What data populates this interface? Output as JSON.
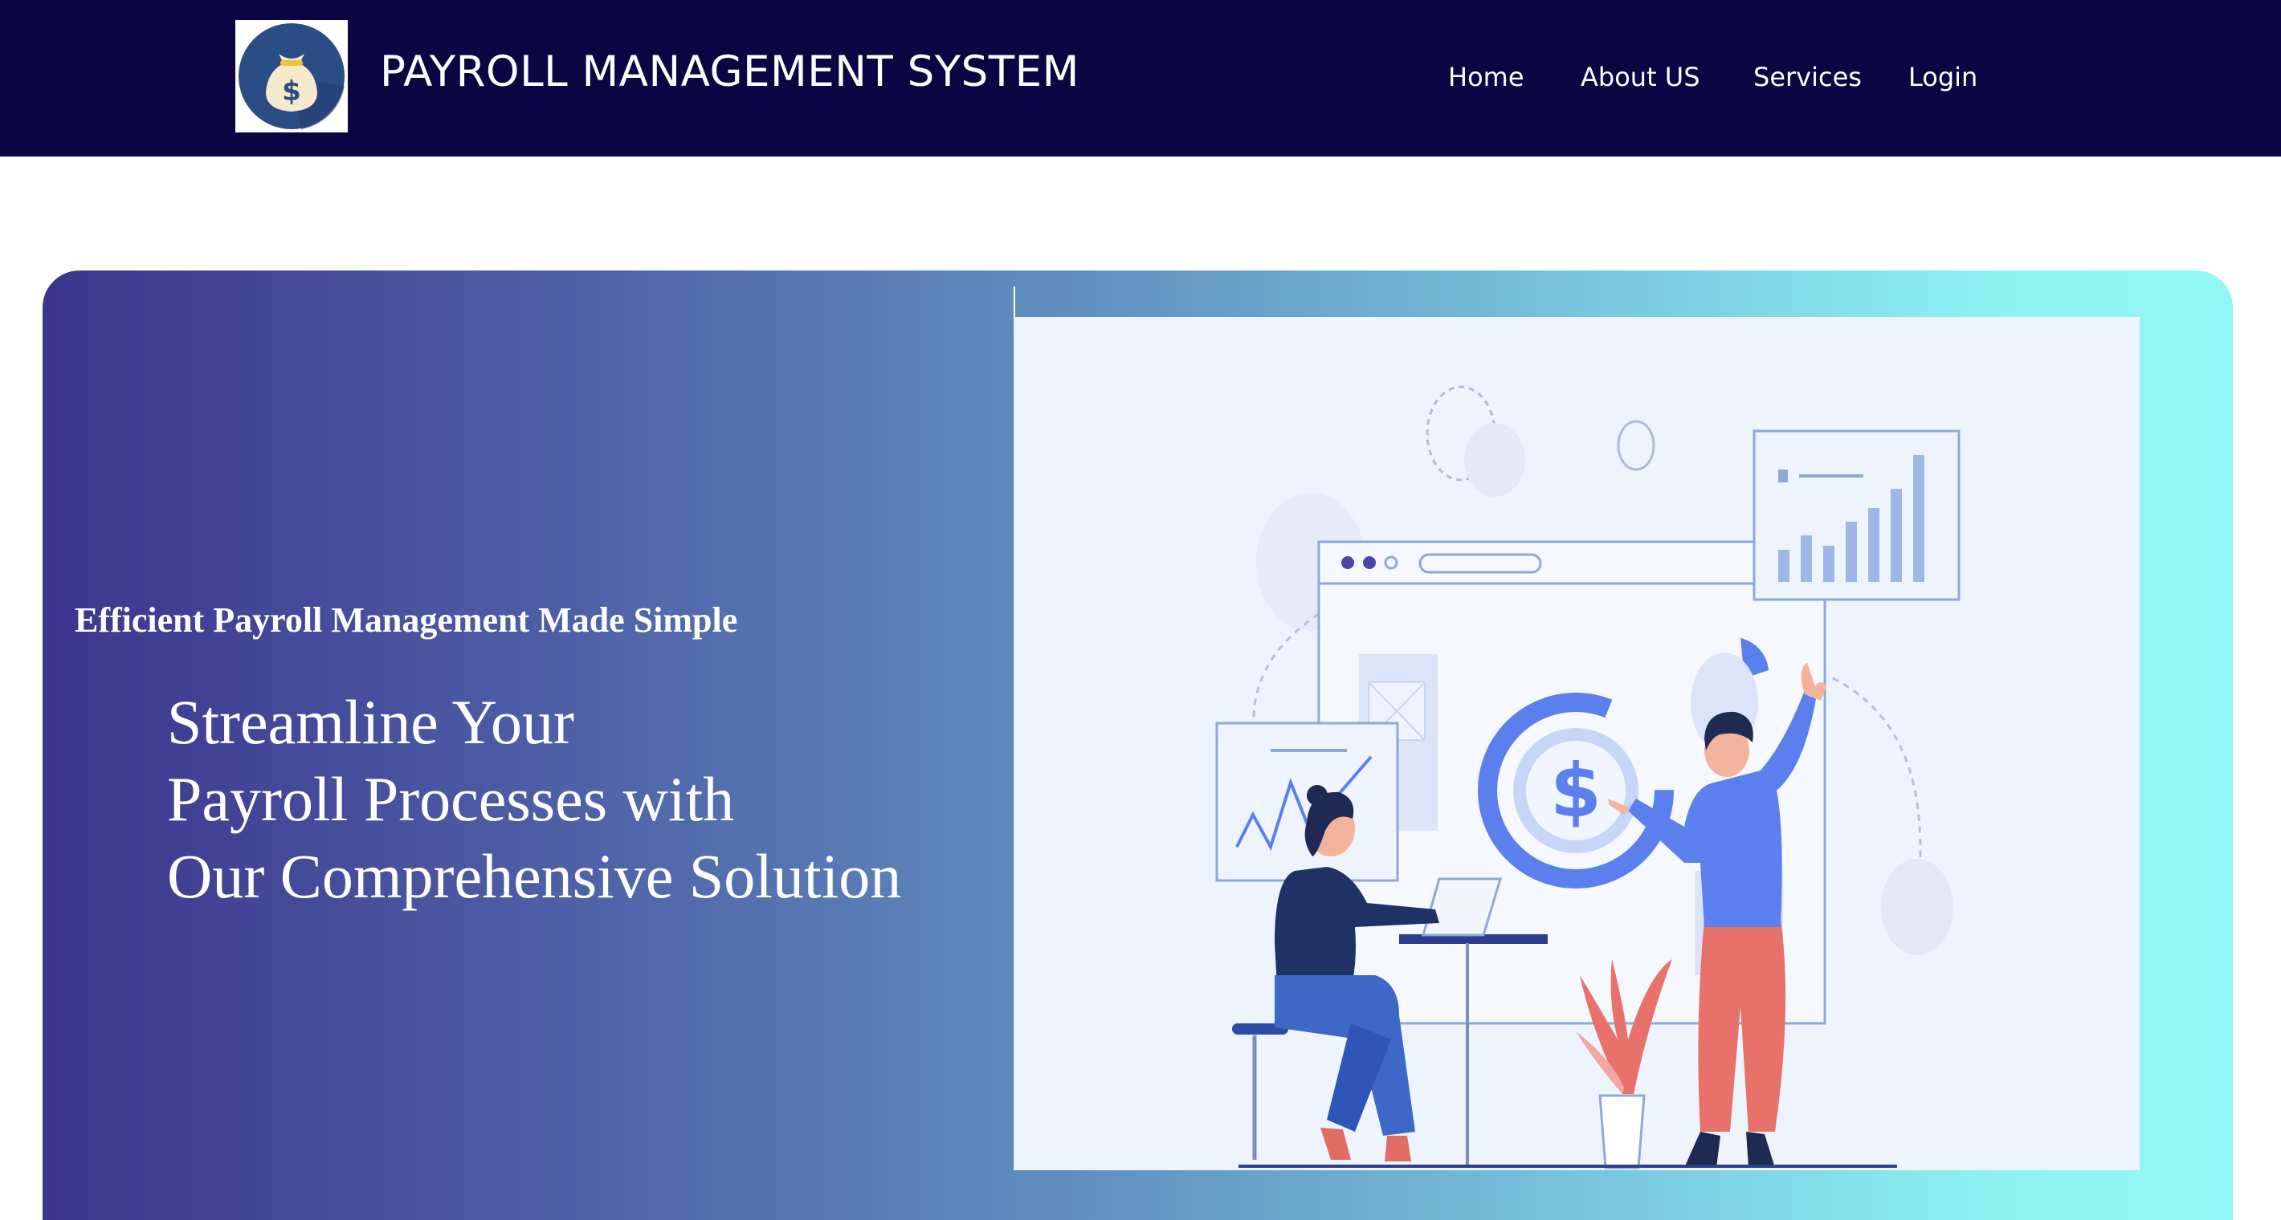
{
  "header": {
    "brand": "PAYROLL MANAGEMENT SYSTEM",
    "logo_icon": "money-bag-icon",
    "nav": [
      {
        "label": "Home"
      },
      {
        "label": "About US"
      },
      {
        "label": "Services"
      },
      {
        "label": "Login"
      }
    ]
  },
  "hero": {
    "kicker": "Efficient Payroll Management Made Simple",
    "headline_lines": [
      "Streamline Your",
      "Payroll Processes with",
      "Our Comprehensive Solution"
    ],
    "illustration_icon": "payroll-analytics-illustration"
  },
  "colors": {
    "header_bg": "#0b0543",
    "accent_blue": "#5b80ee",
    "gradient_start": "#3b358d",
    "gradient_end": "#92f6f4"
  }
}
